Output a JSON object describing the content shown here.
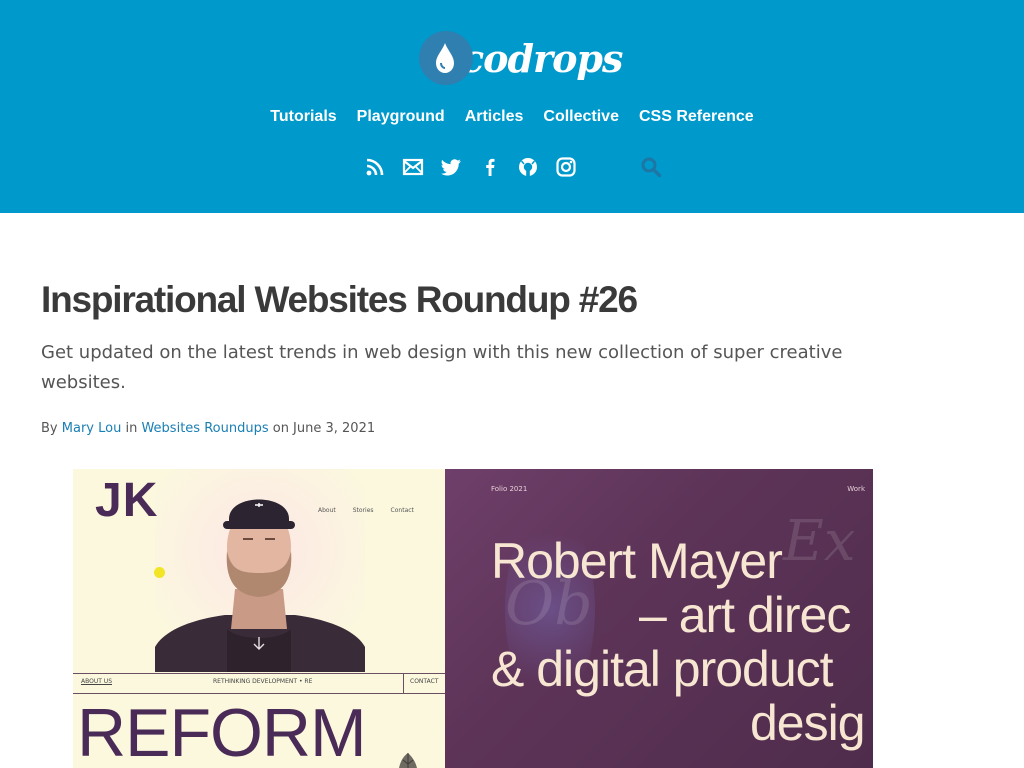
{
  "brand": {
    "logo_text": "codrops"
  },
  "nav": [
    {
      "label": "Tutorials"
    },
    {
      "label": "Playground"
    },
    {
      "label": "Articles"
    },
    {
      "label": "Collective"
    },
    {
      "label": "CSS Reference"
    }
  ],
  "social": [
    {
      "icon": "rss-icon"
    },
    {
      "icon": "mail-icon"
    },
    {
      "icon": "twitter-icon"
    },
    {
      "icon": "facebook-icon"
    },
    {
      "icon": "github-icon"
    },
    {
      "icon": "instagram-icon"
    },
    {
      "icon": "search-icon"
    }
  ],
  "article": {
    "title": "Inspirational Websites Roundup #26",
    "subtitle": "Get updated on the latest trends in web design with this new collection of super creative websites.",
    "meta": {
      "by": "By",
      "author": "Mary Lou",
      "in": "in",
      "category": "Websites Roundups",
      "on": "on June 3, 2021"
    }
  },
  "hero": {
    "left": {
      "monogram": "JK",
      "nav": [
        "About",
        "Stories",
        "Contact"
      ],
      "bar_left": "ABOUT US",
      "bar_center": "RETHINKING DEVELOPMENT  •  RE",
      "bar_right": "CONTACT",
      "headline": "REFORM"
    },
    "right": {
      "folio": "Folio 2021",
      "work": "Work",
      "lines": [
        "Robert Mayer",
        "– art direc",
        "& digital product",
        "desig"
      ]
    }
  },
  "colors": {
    "header_bg": "#0099cc",
    "link": "#1a7fb4",
    "hero_left_bg": "#fbf8de",
    "hero_right_bg": "#5d3458",
    "hero_text": "#f6e6d2"
  }
}
